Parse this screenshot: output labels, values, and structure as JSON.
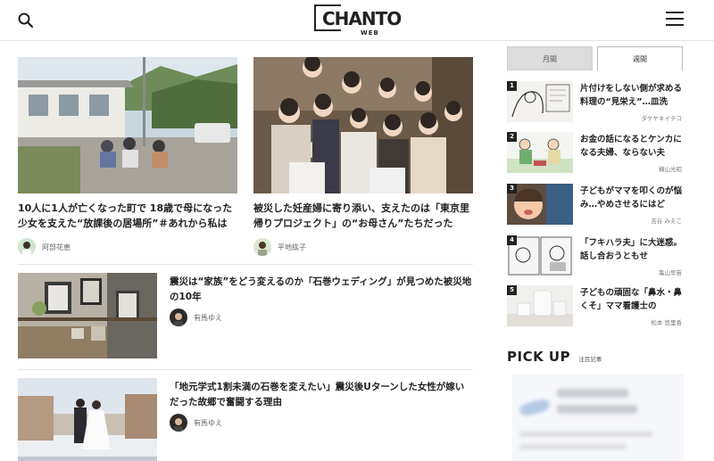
{
  "site": {
    "logo_text": "CHANTO",
    "logo_sub": "WEB"
  },
  "feature_articles": [
    {
      "title": "10人に1人が亡くなった町で 18歳で母になった少女を支えた“放課後の居場所”＃あれから私は",
      "author": "阿部花恵"
    },
    {
      "title": "被災した妊産婦に寄り添い、支えたのは「東京里帰りプロジェクト」の“お母さん”たちだった",
      "author": "平地紘子"
    }
  ],
  "list_articles": [
    {
      "title": "震災は“家族”をどう変えるのか「石巻ウェディング」が見つめた被災地の10年",
      "author": "有馬ゆえ"
    },
    {
      "title": "「地元学式1割未満の石巻を変えたい」震災後Uターンした女性が嫁いだった故郷で奮闘する理由",
      "author": "有馬ゆえ"
    }
  ],
  "ranking": {
    "tabs": {
      "monthly": "月間",
      "weekly": "週間"
    },
    "items": [
      {
        "rank": "1",
        "title": "片付けをしない側が求める料理の“見栄え”…皿洗",
        "author": "タケヤキイチコ"
      },
      {
        "rank": "2",
        "title": "お金の話になるとケンカになる夫婦、ならない夫",
        "author": "横山光昭"
      },
      {
        "rank": "3",
        "title": "子どもがママを叩くのが悩み…やめさせるにはど",
        "author": "吉谷 みえこ"
      },
      {
        "rank": "4",
        "title": "「フキハラ夫」に大迷惑。話し合おうともせ",
        "author": "亀山早苗"
      },
      {
        "rank": "5",
        "title": "子どもの頑固な「鼻水・鼻くそ」ママ看護士の",
        "author": "松本 悠里香"
      }
    ]
  },
  "pickup": {
    "title": "PICK UP",
    "subtitle": "注目記事"
  }
}
